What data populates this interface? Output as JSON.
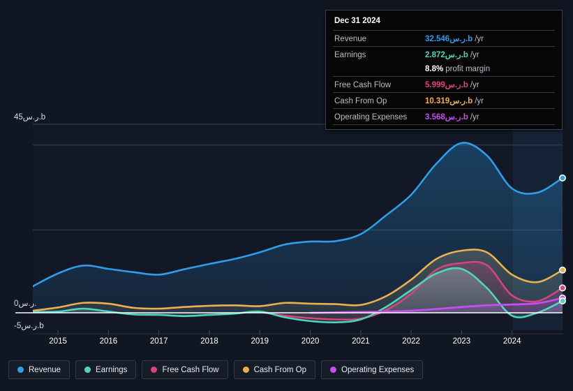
{
  "currency_symbol": "ر.س.",
  "tooltip": {
    "date": "Dec 31 2024",
    "rows": [
      {
        "label": "Revenue",
        "value": "32.546ر.س.b",
        "suffix": "/yr",
        "color": "#2e9eeb"
      },
      {
        "label": "Earnings",
        "value": "2.872ر.س.b",
        "suffix": "/yr",
        "color": "#4fd5bd"
      },
      {
        "label": "Free Cash Flow",
        "value": "5.999ر.س.b",
        "suffix": "/yr",
        "color": "#e0447e"
      },
      {
        "label": "Cash From Op",
        "value": "10.319ر.س.b",
        "suffix": "/yr",
        "color": "#eeb04e"
      },
      {
        "label": "Operating Expenses",
        "value": "3.568ر.س.b",
        "suffix": "/yr",
        "color": "#c44ef0"
      }
    ],
    "profit_margin_value": "8.8%",
    "profit_margin_label": "profit margin"
  },
  "legend": {
    "items": [
      {
        "label": "Revenue",
        "color": "#2e9eeb"
      },
      {
        "label": "Earnings",
        "color": "#4fd5bd"
      },
      {
        "label": "Free Cash Flow",
        "color": "#d6447c"
      },
      {
        "label": "Cash From Op",
        "color": "#eeb04e"
      },
      {
        "label": "Operating Expenses",
        "color": "#c44ef0"
      }
    ]
  },
  "axes": {
    "y_top_label": "45ر.س.b",
    "y_zero_label": "0ر.س.",
    "y_bottom_label": "-5ر.س.b",
    "x_labels": [
      "2015",
      "2016",
      "2017",
      "2018",
      "2019",
      "2020",
      "2021",
      "2022",
      "2023",
      "2024"
    ]
  },
  "chart_data": {
    "type": "area",
    "title": "",
    "xlabel": "",
    "ylabel": "ر.س.b",
    "ylim": [
      -5,
      45
    ],
    "grid": true,
    "legend_position": "bottom",
    "x_tick_labels": [
      "2015",
      "2016",
      "2017",
      "2018",
      "2019",
      "2020",
      "2021",
      "2022",
      "2023",
      "2024"
    ],
    "x": [
      2014.5,
      2015,
      2015.5,
      2016,
      2016.5,
      2017,
      2017.5,
      2018,
      2018.5,
      2019,
      2019.5,
      2020,
      2020.5,
      2021,
      2021.5,
      2022,
      2022.5,
      2023,
      2023.5,
      2024,
      2024.5,
      2025
    ],
    "series": [
      {
        "name": "Revenue",
        "color": "#2e9eeb",
        "values": [
          6.4,
          9.5,
          11.4,
          10.6,
          9.8,
          9.2,
          10.5,
          11.8,
          13.0,
          14.6,
          16.5,
          17.2,
          17.3,
          19.0,
          23.5,
          28.5,
          36.0,
          41.0,
          38.0,
          30.0,
          29.0,
          32.546
        ]
      },
      {
        "name": "Cash From Op",
        "color": "#eeb04e",
        "values": [
          0.5,
          1.3,
          2.4,
          2.2,
          1.2,
          1.0,
          1.4,
          1.7,
          1.8,
          1.6,
          2.4,
          2.2,
          2.1,
          1.9,
          4.0,
          8.0,
          13.0,
          15.0,
          14.6,
          9.2,
          7.4,
          10.319
        ]
      },
      {
        "name": "Free Cash Flow",
        "color": "#d6447c",
        "values": [
          null,
          null,
          null,
          null,
          null,
          null,
          null,
          null,
          null,
          0.2,
          -0.7,
          -1.3,
          -1.6,
          -1.4,
          0.6,
          4.6,
          10.4,
          12.0,
          11.5,
          4.2,
          2.8,
          5.999
        ]
      },
      {
        "name": "Earnings",
        "color": "#4fd5bd",
        "values": [
          0.2,
          0.3,
          1.0,
          0.3,
          -0.4,
          -0.5,
          -0.8,
          -0.5,
          -0.2,
          0.3,
          -1.1,
          -2.0,
          -2.3,
          -1.6,
          1.4,
          5.5,
          9.5,
          10.6,
          6.0,
          -0.7,
          0.0,
          2.872
        ]
      },
      {
        "name": "Operating Expenses",
        "color": "#c44ef0",
        "values": [
          null,
          null,
          null,
          null,
          null,
          null,
          null,
          null,
          null,
          null,
          null,
          0.0,
          0.1,
          0.2,
          0.3,
          0.5,
          0.9,
          1.4,
          1.8,
          2.0,
          2.3,
          3.568
        ]
      }
    ],
    "endpoints": [
      {
        "name": "Revenue",
        "value": 32.546,
        "color": "#2e9eeb"
      },
      {
        "name": "Cash From Op",
        "value": 10.319,
        "color": "#eeb04e"
      },
      {
        "name": "Free Cash Flow",
        "value": 5.999,
        "color": "#d6447c"
      },
      {
        "name": "Operating Expenses",
        "value": 3.568,
        "color": "#c44ef0"
      },
      {
        "name": "Earnings",
        "value": 2.872,
        "color": "#4fd5bd"
      }
    ]
  }
}
